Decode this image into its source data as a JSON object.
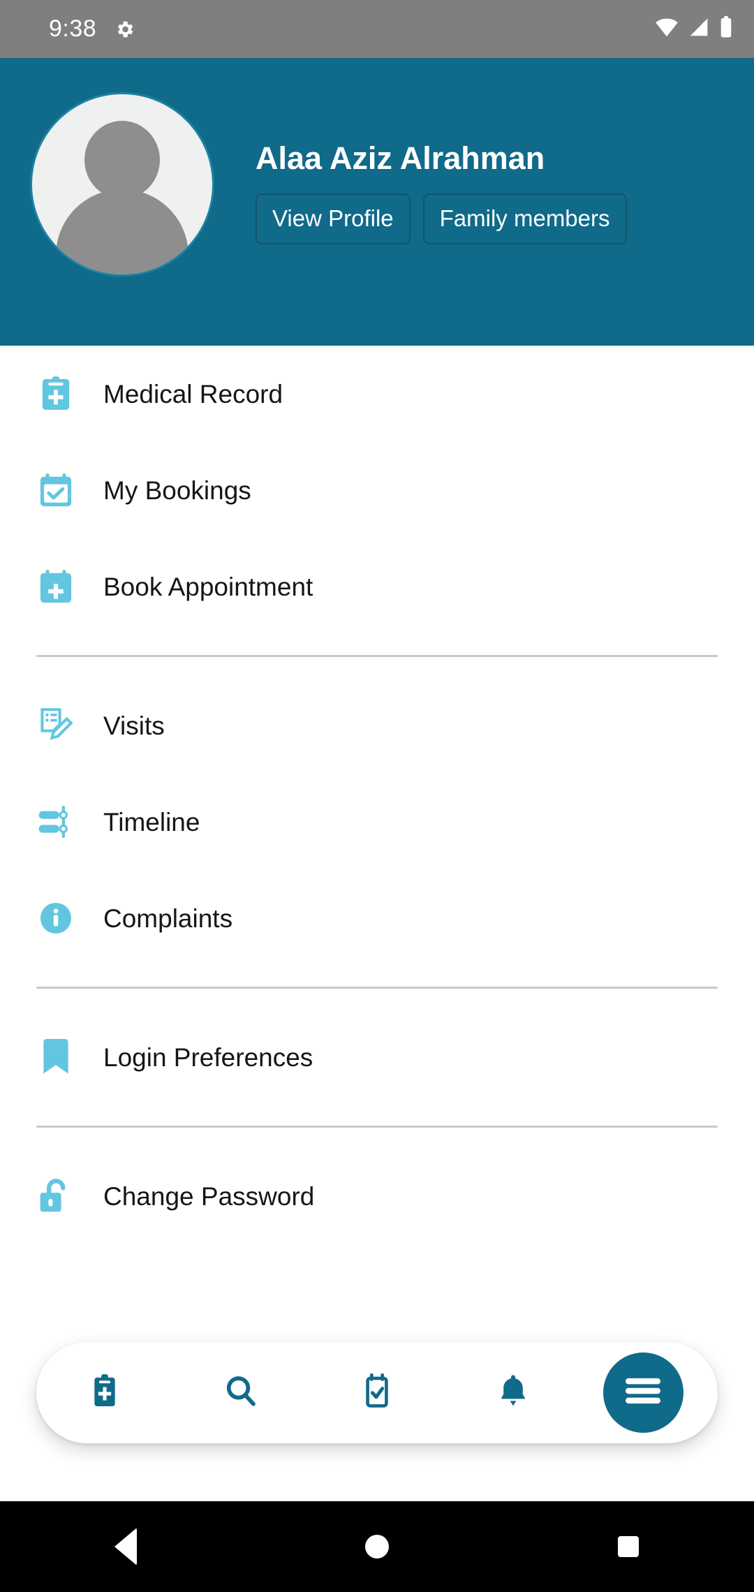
{
  "status_bar": {
    "time": "9:38",
    "icons": [
      "gear-icon",
      "wifi-icon",
      "cellular-signal-icon",
      "battery-icon"
    ],
    "background_color": "#7f7f7f"
  },
  "header": {
    "background_color": "#106A8A",
    "avatar_alt": "user-avatar-placeholder",
    "user_name": "Alaa Aziz Alrahman",
    "buttons": [
      {
        "label": "View Profile",
        "name": "view-profile-button"
      },
      {
        "label": "Family members",
        "name": "family-members-button"
      }
    ]
  },
  "menu": {
    "icon_color": "#63C6E0",
    "groups": [
      {
        "items": [
          {
            "label": "Medical Record",
            "icon": "clipboard-plus-icon"
          },
          {
            "label": "My Bookings",
            "icon": "calendar-check-icon"
          },
          {
            "label": "Book Appointment",
            "icon": "calendar-plus-icon"
          }
        ]
      },
      {
        "items": [
          {
            "label": "Visits",
            "icon": "note-pencil-icon"
          },
          {
            "label": "Timeline",
            "icon": "timeline-sliders-icon"
          },
          {
            "label": "Complaints",
            "icon": "info-circle-icon"
          }
        ]
      },
      {
        "items": [
          {
            "label": "Login Preferences",
            "icon": "bookmark-icon"
          }
        ]
      },
      {
        "items": [
          {
            "label": "Change Password",
            "icon": "unlock-icon"
          }
        ]
      }
    ]
  },
  "bottom_nav": {
    "accent_color": "#106A8A",
    "items": [
      {
        "icon": "clipboard-plus-icon",
        "name": "nav-medical-record",
        "active": false
      },
      {
        "icon": "search-icon",
        "name": "nav-search",
        "active": false
      },
      {
        "icon": "calendar-check-icon",
        "name": "nav-bookings",
        "active": false
      },
      {
        "icon": "bell-icon",
        "name": "nav-notifications",
        "active": false
      },
      {
        "icon": "hamburger-menu-icon",
        "name": "nav-menu",
        "active": true
      }
    ]
  },
  "android_nav": {
    "buttons": [
      {
        "icon": "back-triangle-icon",
        "name": "android-back-button"
      },
      {
        "icon": "home-circle-icon",
        "name": "android-home-button"
      },
      {
        "icon": "recents-square-icon",
        "name": "android-recents-button"
      }
    ]
  }
}
